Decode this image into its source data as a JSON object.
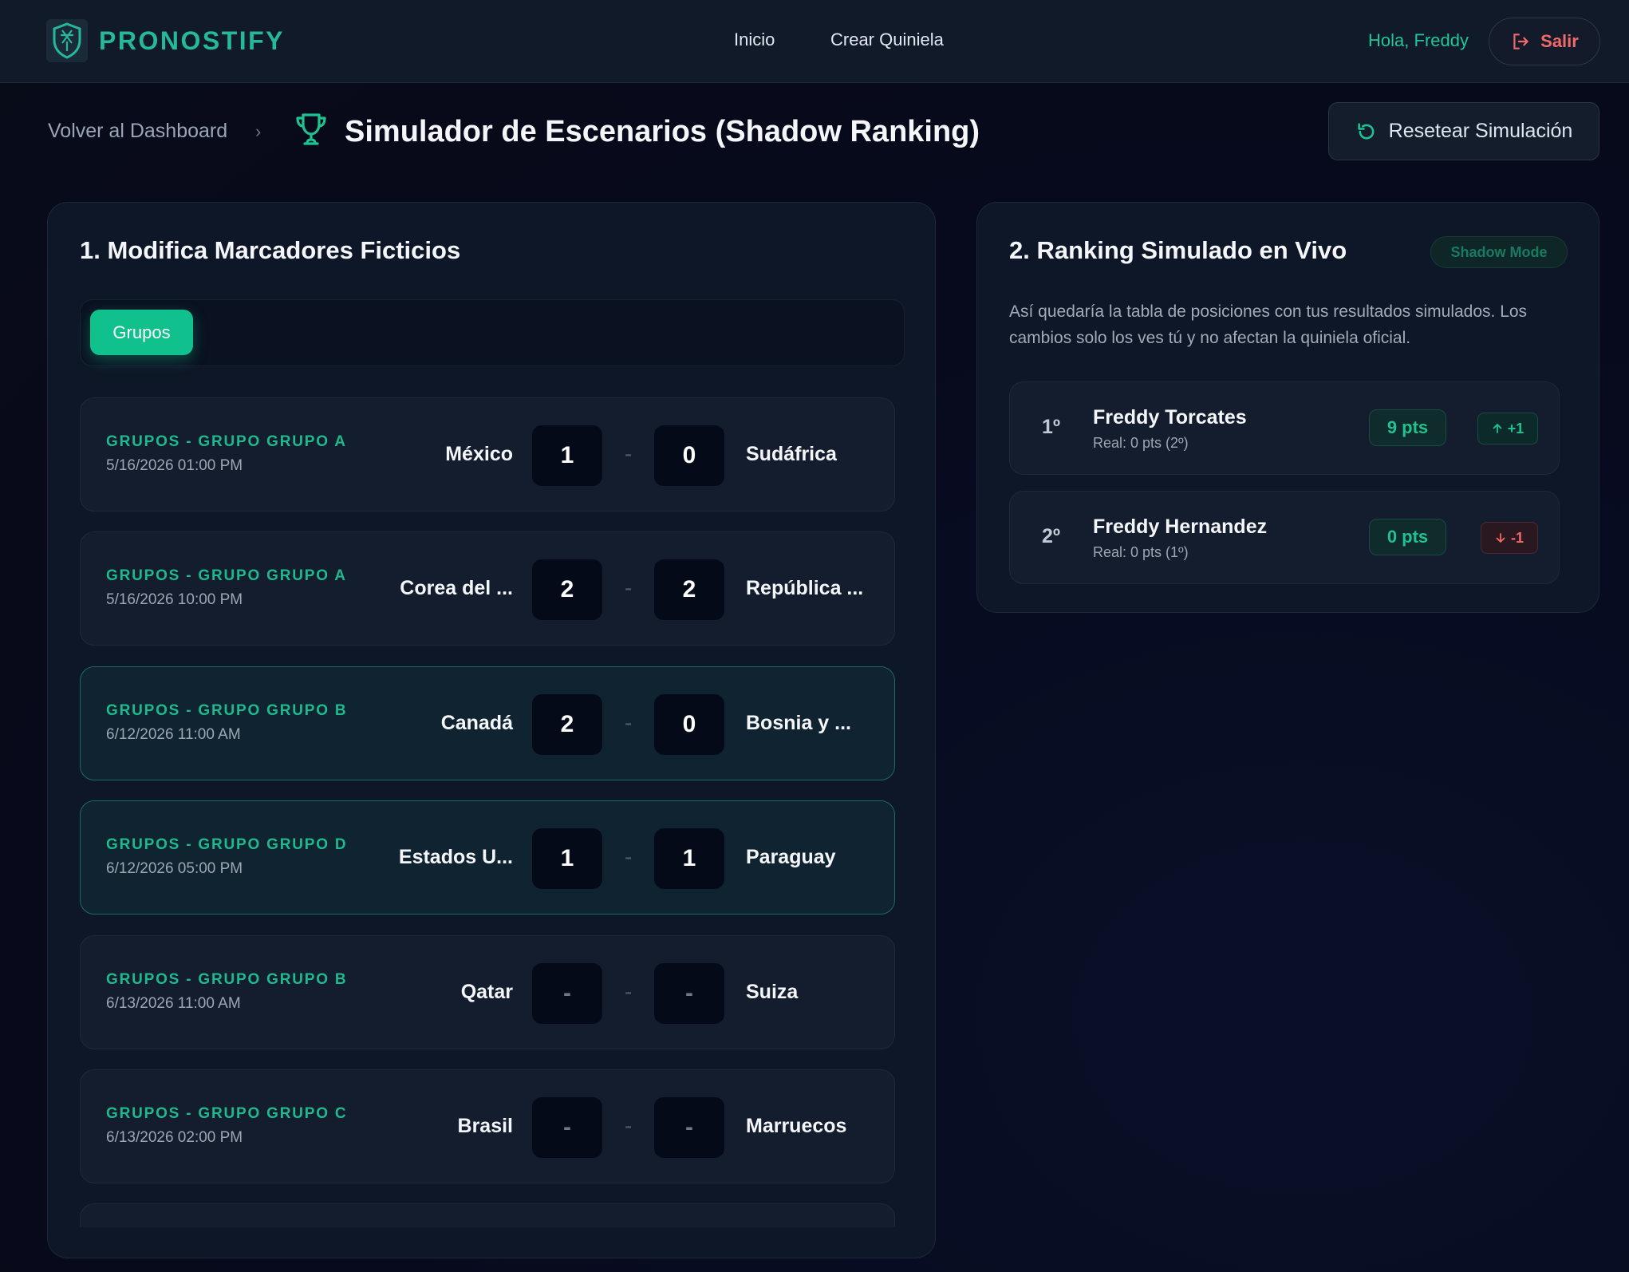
{
  "header": {
    "brand": "PRONOSTIFY",
    "nav": [
      "Inicio",
      "Crear Quiniela"
    ],
    "greeting": "Hola, Freddy",
    "logout_label": "Salir"
  },
  "breadcrumb": {
    "back_label": "Volver al Dashboard",
    "separator": "›"
  },
  "page": {
    "title": "Simulador de Escenarios (Shadow Ranking)",
    "reset_label": "Resetear Simulación"
  },
  "scores_panel": {
    "title": "1. Modifica Marcadores Ficticios",
    "tabs": [
      "Grupos"
    ],
    "score_separator": "-",
    "matches": [
      {
        "group": "GRUPOS - GRUPO GRUPO A",
        "date": "5/16/2026 01:00 PM",
        "home": "México",
        "home_score": "1",
        "away_score": "0",
        "away": "Sudáfrica"
      },
      {
        "group": "GRUPOS - GRUPO GRUPO A",
        "date": "5/16/2026 10:00 PM",
        "home": "Corea del ...",
        "home_score": "2",
        "away_score": "2",
        "away": "República ..."
      },
      {
        "group": "GRUPOS - GRUPO GRUPO B",
        "date": "6/12/2026 11:00 AM",
        "home": "Canadá",
        "home_score": "2",
        "away_score": "0",
        "away": "Bosnia y ..."
      },
      {
        "group": "GRUPOS - GRUPO GRUPO D",
        "date": "6/12/2026 05:00 PM",
        "home": "Estados U...",
        "home_score": "1",
        "away_score": "1",
        "away": "Paraguay"
      },
      {
        "group": "GRUPOS - GRUPO GRUPO B",
        "date": "6/13/2026 11:00 AM",
        "home": "Qatar",
        "home_score": "-",
        "away_score": "-",
        "away": "Suiza"
      },
      {
        "group": "GRUPOS - GRUPO GRUPO C",
        "date": "6/13/2026 02:00 PM",
        "home": "Brasil",
        "home_score": "-",
        "away_score": "-",
        "away": "Marruecos"
      }
    ]
  },
  "ranking_panel": {
    "title": "2. Ranking Simulado en Vivo",
    "badge": "Shadow Mode",
    "description": "Así quedaría la tabla de posiciones con tus resultados simulados. Los cambios solo los ves tú y no afectan la quiniela oficial.",
    "rows": [
      {
        "position": "1º",
        "name": "Freddy Torcates",
        "real": "Real: 0 pts (2º)",
        "points": "9 pts",
        "delta": "+1"
      },
      {
        "position": "2º",
        "name": "Freddy Hernandez",
        "real": "Real: 0 pts (1º)",
        "points": "0 pts",
        "delta": "-1"
      }
    ]
  },
  "colors": {
    "accent": "#10c18e",
    "brand": "#25b89a",
    "danger": "#f06a6a",
    "background": "#070a1c",
    "card": "#131d2d"
  }
}
